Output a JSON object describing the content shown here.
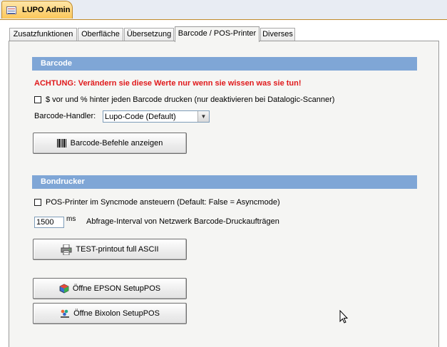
{
  "window": {
    "doc_tab_title": "LUPO Admin"
  },
  "tabs": [
    {
      "label": "Zusatzfunktionen",
      "active": false
    },
    {
      "label": "Oberfläche",
      "active": false
    },
    {
      "label": "Übersetzung",
      "active": false
    },
    {
      "label": "Barcode / POS-Printer",
      "active": true
    },
    {
      "label": "Diverses",
      "active": false
    }
  ],
  "barcode": {
    "section_title": "Barcode",
    "warning": "ACHTUNG: Verändern sie diese Werte nur wenn sie wissen was sie tun!",
    "checkbox_label": "$ vor und % hinter jeden Barcode drucken (nur deaktivieren bei Datalogic-Scanner)",
    "checkbox_checked": false,
    "handler_label": "Barcode-Handler:",
    "handler_value": "Lupo-Code (Default)",
    "show_commands_button": "Barcode-Befehle anzeigen"
  },
  "bondrucker": {
    "section_title": "Bondrucker",
    "syncmode_label": "POS-Printer im Syncmode ansteuern (Default: False = Asyncmode)",
    "syncmode_checked": false,
    "interval_value": "1500",
    "interval_unit": "ms",
    "interval_label": "Abfrage-Interval von Netzwerk Barcode-Druckaufträgen",
    "test_button": "TEST-printout full ASCII",
    "epson_button": "Öffne EPSON SetupPOS",
    "bixolon_button": "Öffne Bixolon SetupPOS"
  },
  "icons": {
    "form": "form-icon",
    "barcode": "barcode-icon",
    "printer": "printer-icon",
    "epson": "epson-setup-icon",
    "bixolon": "bixolon-setup-icon",
    "cursor": "mouse-cursor-icon"
  },
  "colors": {
    "section_bar": "#7fa6d6",
    "warning": "#e0191b",
    "doc_tab": "#fbc75a"
  }
}
